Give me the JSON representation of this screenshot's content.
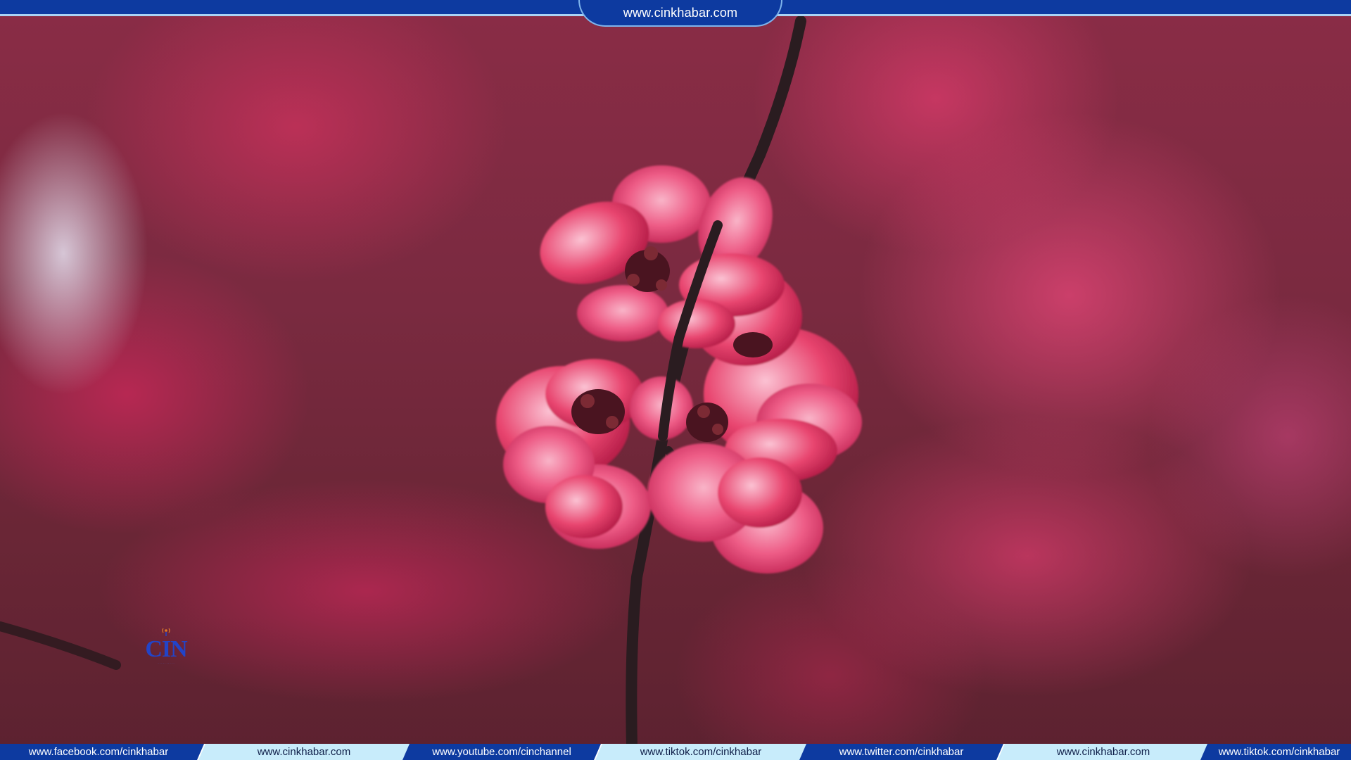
{
  "header": {
    "site_url": "www.cinkhabar.com"
  },
  "logo": {
    "text": "CIN",
    "icon": "broadcast-antenna-icon",
    "brand_color": "#2244c8"
  },
  "ticker": {
    "items": [
      {
        "label": "www.facebook.com/cinkhabar",
        "style": "dark"
      },
      {
        "label": "www.cinkhabar.com",
        "style": "light"
      },
      {
        "label": "www.youtube.com/cinchannel",
        "style": "dark"
      },
      {
        "label": "www.tiktok.com/cinkhabar",
        "style": "light"
      },
      {
        "label": "www.twitter.com/cinkhabar",
        "style": "dark"
      },
      {
        "label": "www.cinkhabar.com",
        "style": "light"
      },
      {
        "label": "www.tiktok.com/cinkhabar",
        "style": "dark"
      }
    ]
  },
  "colors": {
    "banner_blue": "#0d3aa0",
    "ticker_light": "#c8ecfb",
    "blossom_pink": "#e8396b"
  }
}
